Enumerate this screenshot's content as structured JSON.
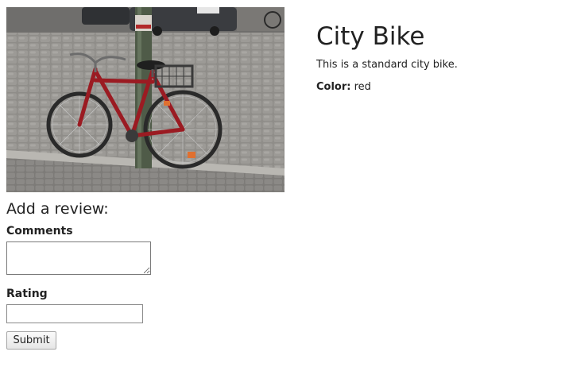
{
  "product": {
    "title": "City Bike",
    "description": "This is a standard city bike.",
    "color_label": "Color:",
    "color_value": "red"
  },
  "review": {
    "heading": "Add a review:",
    "comments_label": "Comments",
    "comments_value": "",
    "rating_label": "Rating",
    "rating_value": "",
    "submit_label": "Submit"
  },
  "colors": {
    "bike_frame": "#9b1b22",
    "cobblestone": "#8d8b88",
    "pole": "#4d5a46",
    "text": "#222222"
  }
}
